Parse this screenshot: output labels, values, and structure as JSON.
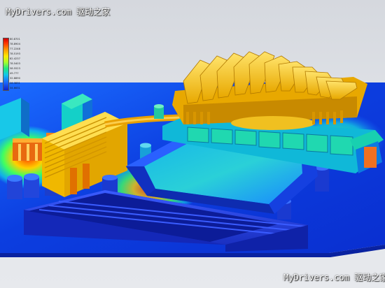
{
  "watermark": {
    "top": "MyDrivers.com 驱动之家",
    "bottom": "MyDrivers.com 驱动之家"
  },
  "legend": {
    "ticks": [
      "80.8701",
      "78.8904",
      "77.2248",
      "78.5193",
      "82.4237",
      "78.5403",
      "58.5523",
      "49.777",
      "32.8890",
      "26.3831",
      "34.6631"
    ],
    "colors": [
      "#d40000",
      "#ff9a00",
      "#ffe800",
      "#21e87f",
      "#11c8e8",
      "#1a6cff",
      "#1020c8"
    ]
  },
  "scene": {
    "background_color": "#dadde3",
    "board_color": "#0d3fe0",
    "heatsink_color": "#f5c518"
  }
}
